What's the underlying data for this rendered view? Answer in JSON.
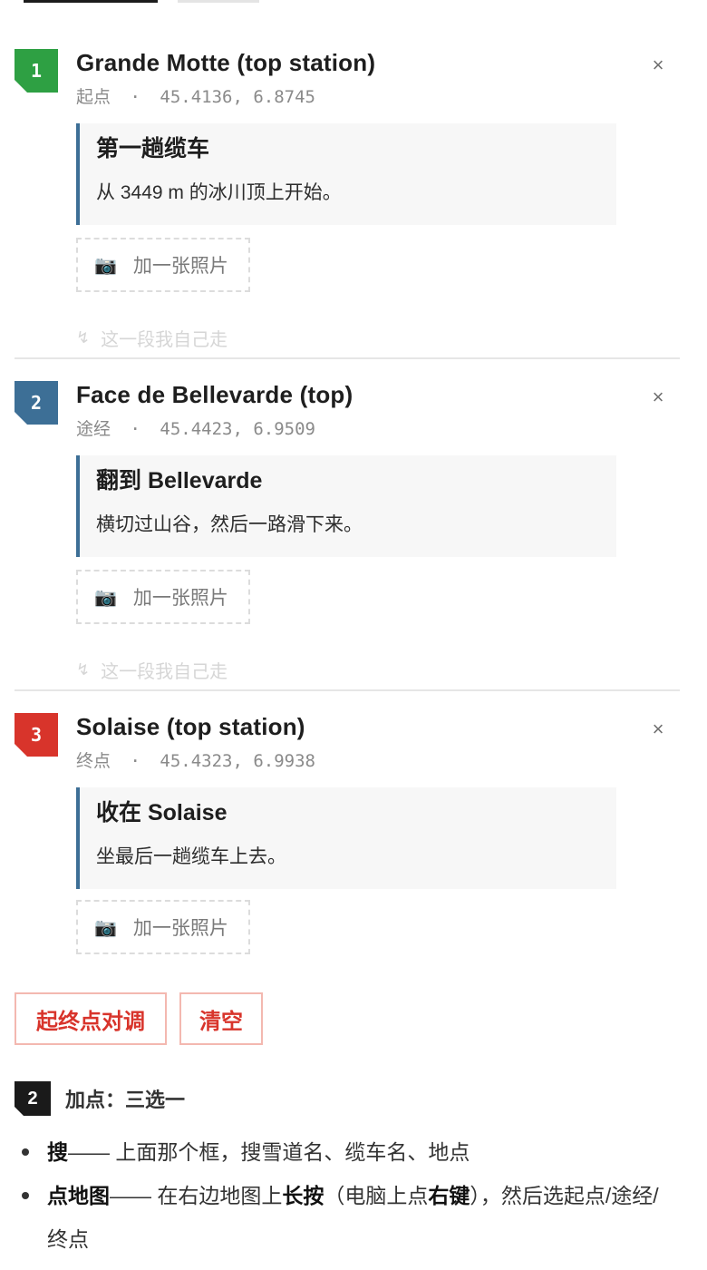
{
  "stops": [
    {
      "index": "1",
      "badge_color": "#2ea043",
      "name": "Grande Motte (top station)",
      "role": "起点",
      "coords": "45.4136, 6.8745",
      "note_title": "第一趟缆车",
      "note_body": "从 3449 m 的冰川顶上开始。",
      "photo_label": "加一张照片",
      "walk_label": "这一段我自己走"
    },
    {
      "index": "2",
      "badge_color": "#3d6f96",
      "name": "Face de Bellevarde (top)",
      "role": "途经",
      "coords": "45.4423, 6.9509",
      "note_title": "翻到 Bellevarde",
      "note_body": "横切过山谷，然后一路滑下来。",
      "photo_label": "加一张照片",
      "walk_label": "这一段我自己走"
    },
    {
      "index": "3",
      "badge_color": "#d8342b",
      "name": "Solaise (top station)",
      "role": "终点",
      "coords": "45.4323, 6.9938",
      "note_title": "收在 Solaise",
      "note_body": "坐最后一趟缆车上去。",
      "photo_label": "加一张照片"
    }
  ],
  "meta_separator": "·",
  "remove_glyph": "×",
  "actions": {
    "swap_label": "起终点对调",
    "clear_label": "清空"
  },
  "section": {
    "number": "2",
    "title": "加点：三选一"
  },
  "tips": {
    "search_bold": "搜",
    "search_rest": "—— 上面那个框，搜雪道名、缆车名、地点",
    "map_bold": "点地图",
    "map_rest_1": "—— 在右边地图上",
    "map_bold_2": "长按",
    "map_rest_2": "（电脑上点",
    "map_bold_3": "右键",
    "map_rest_3": "），然后选起点/途经/终点"
  },
  "colors": {
    "accent_red": "#d8342b",
    "note_border": "#3d6f96"
  }
}
